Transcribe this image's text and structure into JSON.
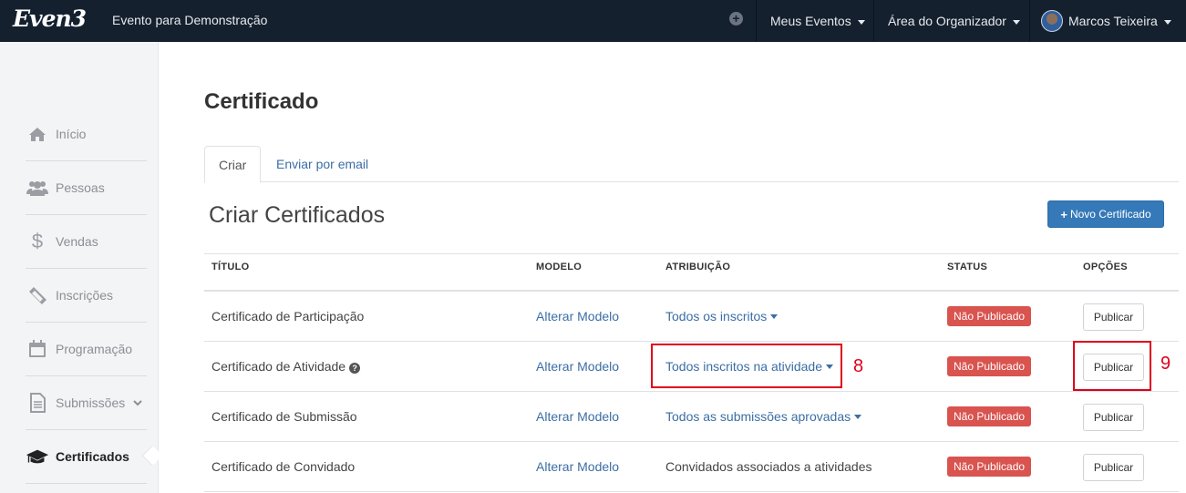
{
  "topbar": {
    "logo": "Even3",
    "event_name": "Evento para Demonstração",
    "nav": [
      {
        "label": "Meus Eventos"
      },
      {
        "label": "Área do Organizador"
      },
      {
        "label": "Marcos Teixeira"
      }
    ]
  },
  "sidebar": {
    "items": [
      {
        "label": "Início",
        "icon": "home-icon"
      },
      {
        "label": "Pessoas",
        "icon": "users-icon"
      },
      {
        "label": "Vendas",
        "icon": "dollar-icon"
      },
      {
        "label": "Inscrições",
        "icon": "ticket-icon"
      },
      {
        "label": "Programação",
        "icon": "calendar-icon"
      },
      {
        "label": "Submissões",
        "icon": "file-icon"
      },
      {
        "label": "Certificados",
        "icon": "graduation-cap-icon",
        "active": true
      }
    ]
  },
  "main": {
    "title": "Certificado",
    "tabs": [
      {
        "label": "Criar"
      },
      {
        "label": "Enviar por email"
      }
    ],
    "section_title": "Criar Certificados",
    "new_button": "Novo Certificado",
    "table": {
      "headers": [
        "TÍTULO",
        "MODELO",
        "ATRIBUIÇÃO",
        "STATUS",
        "OPÇÕES"
      ],
      "rows": [
        {
          "title": "Certificado de Participação",
          "model": "Alterar Modelo",
          "attribution": "Todos os inscritos",
          "status": "Não Publicado",
          "action": "Publicar"
        },
        {
          "title": "Certificado de Atividade",
          "model": "Alterar Modelo",
          "attribution": "Todos inscritos na atividade",
          "status": "Não Publicado",
          "action": "Publicar"
        },
        {
          "title": "Certificado de Submissão",
          "model": "Alterar Modelo",
          "attribution": "Todos as submissões aprovadas",
          "status": "Não Publicado",
          "action": "Publicar"
        },
        {
          "title": "Certificado de Convidado",
          "model": "Alterar Modelo",
          "attribution": "Convidados associados a atividades",
          "status": "Não Publicado",
          "action": "Publicar"
        }
      ]
    }
  },
  "annotations": {
    "label_a": "8",
    "label_b": "9"
  },
  "colors": {
    "topbar": "#14202e",
    "primary": "#3579b8",
    "danger": "#d9534f",
    "highlight": "#e0001b"
  }
}
